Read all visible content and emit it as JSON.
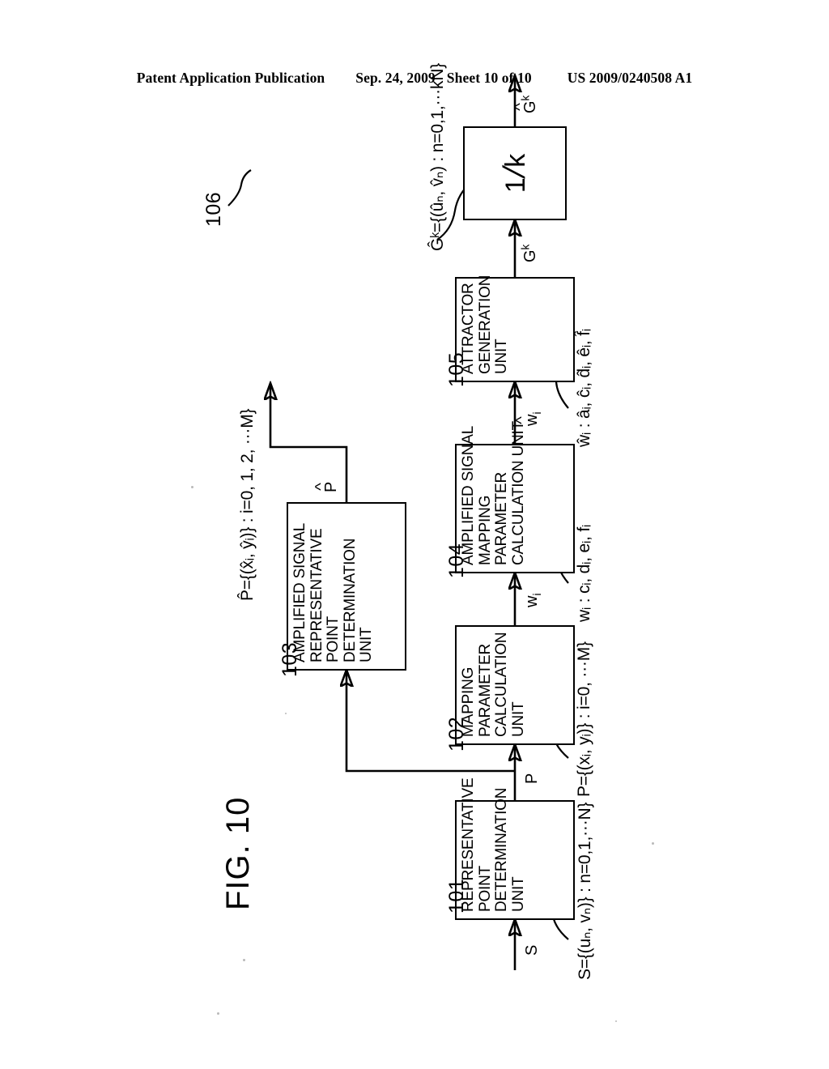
{
  "header": {
    "publication": "Patent Application Publication",
    "date": "Sep. 24, 2009",
    "sheet": "Sheet 10 of 10",
    "patent_number": "US 2009/0240508 A1"
  },
  "figure": {
    "title": "FIG. 10",
    "blocks": [
      {
        "ref": "101",
        "lines": [
          "REPRESENTATIVE",
          "POINT",
          "DETERMINATION",
          "UNIT"
        ]
      },
      {
        "ref": "102",
        "lines": [
          "MAPPING",
          "PARAMETER",
          "CALCULATION",
          "UNIT"
        ]
      },
      {
        "ref": "103",
        "lines": [
          "AMPLIFIED SIGNAL",
          "REPRESENTATIVE",
          "POINT",
          "DETERMINATION",
          "UNIT"
        ]
      },
      {
        "ref": "104",
        "lines": [
          "AMPLIFIED SIGNAL",
          "MAPPING",
          "PARAMETER",
          "CALCULATION UNIT"
        ]
      },
      {
        "ref": "105",
        "lines": [
          "ATTRACTOR",
          "GENERATION",
          "UNIT"
        ]
      },
      {
        "ref": "106",
        "operator_numerator": "1",
        "operator_slash": "/",
        "operator_denominator": "k"
      }
    ],
    "signals": {
      "input_s": "S",
      "p_plain": "P",
      "p_hat": "P̂",
      "w_plain": "w",
      "w_plain_sub": "i",
      "w_hat": "ŵ",
      "w_hat_sub": "i",
      "gk": "G",
      "gk_sup": "k",
      "gk_hat": "Ĝ",
      "gk_hat_sup": "k"
    },
    "annotations": {
      "input_set": "S={(uₙ, vₙ)} : n=0,1,···N}",
      "rep_points": "P={(xᵢ, yᵢ)} : i=0, ···M}",
      "amp_rep_points": "P̂={(x̂ᵢ, ŷᵢ)} : i=0, 1, 2, ···M}",
      "map_params": "wᵢ : cᵢ, dᵢ, eᵢ, fᵢ",
      "amp_map_params": "ŵᵢ : âᵢ, ĉᵢ, d̂ᵢ, êᵢ, f̂ᵢ",
      "output_set": "Ĝᵏ={(ûₙ, v̂ₙ) : n=0,1,···kN}"
    }
  }
}
